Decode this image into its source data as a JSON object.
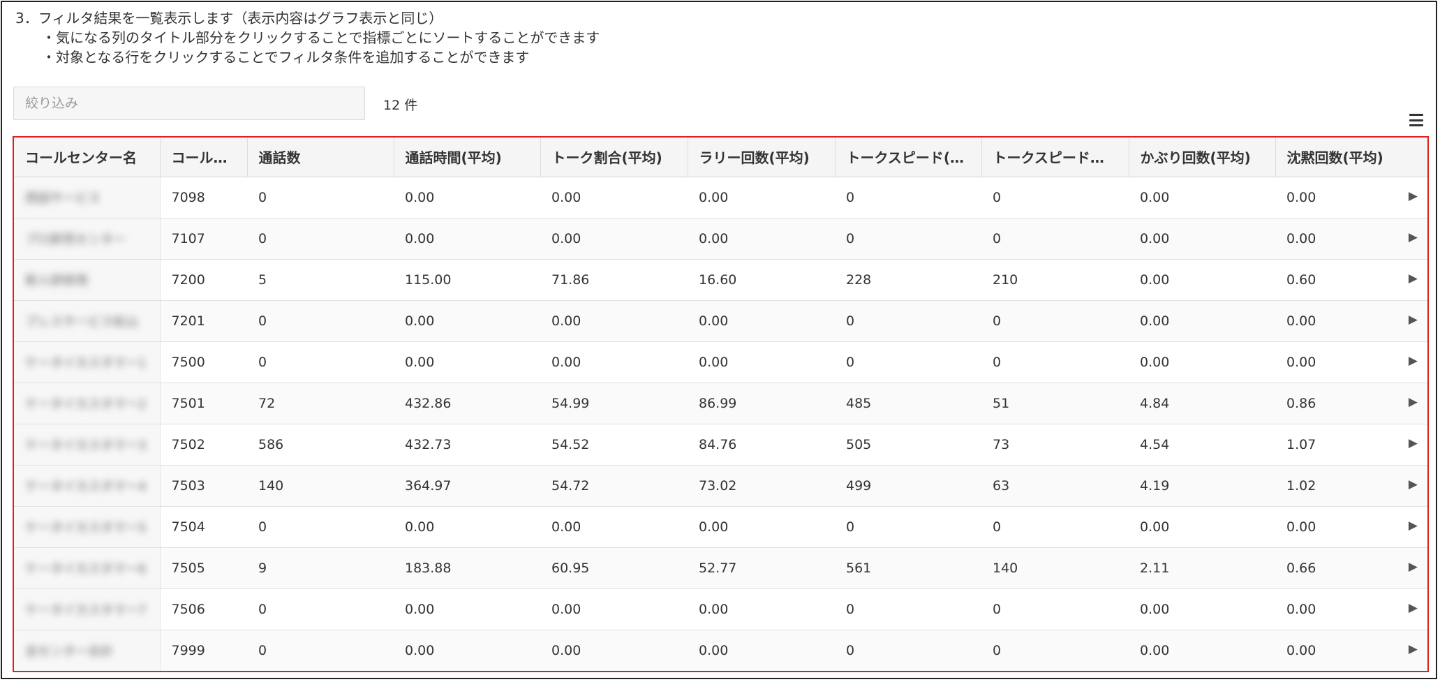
{
  "instructions": {
    "line1": "3．フィルタ結果を一覧表示します（表示内容はグラフ表示と同じ）",
    "line2": "・気になる列のタイトル部分をクリックすることで指標ごとにソートすることができます",
    "line3": "・対象となる行をクリックすることでフィルタ条件を追加することができます"
  },
  "filter": {
    "placeholder": "絞り込み",
    "value": ""
  },
  "count_label": "12 件",
  "icons": {
    "menu": "hamburger-menu-icon",
    "row": "play-arrow-icon"
  },
  "colors": {
    "highlight_border": "#e0201c"
  },
  "table": {
    "headers": [
      "コールセンター名",
      "コール…",
      "通話数",
      "通話時間(平均)",
      "トーク割合(平均)",
      "ラリー回数(平均)",
      "トークスピード(…",
      "トークスピード差…",
      "かぶり回数(平均)",
      "沈黙回数(平均)"
    ],
    "rows": [
      [
        "西田サービス",
        "7098",
        "0",
        "0.00",
        "0.00",
        "0.00",
        "0",
        "0",
        "0.00",
        "0.00"
      ],
      [
        "プロ卸売センター",
        "7107",
        "0",
        "0.00",
        "0.00",
        "0.00",
        "0",
        "0",
        "0.00",
        "0.00"
      ],
      [
        "新入研修用",
        "7200",
        "5",
        "115.00",
        "71.86",
        "16.60",
        "228",
        "210",
        "0.00",
        "0.60"
      ],
      [
        "ブレスサービス松山",
        "7201",
        "0",
        "0.00",
        "0.00",
        "0.00",
        "0",
        "0",
        "0.00",
        "0.00"
      ],
      [
        "ケータイカスタマー1",
        "7500",
        "0",
        "0.00",
        "0.00",
        "0.00",
        "0",
        "0",
        "0.00",
        "0.00"
      ],
      [
        "ケータイカスタマー2",
        "7501",
        "72",
        "432.86",
        "54.99",
        "86.99",
        "485",
        "51",
        "4.84",
        "0.86"
      ],
      [
        "ケータイカスタマー3",
        "7502",
        "586",
        "432.73",
        "54.52",
        "84.76",
        "505",
        "73",
        "4.54",
        "1.07"
      ],
      [
        "ケータイカスタマー4",
        "7503",
        "140",
        "364.97",
        "54.72",
        "73.02",
        "499",
        "63",
        "4.19",
        "1.02"
      ],
      [
        "ケータイカスタマー5",
        "7504",
        "0",
        "0.00",
        "0.00",
        "0.00",
        "0",
        "0",
        "0.00",
        "0.00"
      ],
      [
        "ケータイカスタマー6",
        "7505",
        "9",
        "183.88",
        "60.95",
        "52.77",
        "561",
        "140",
        "2.11",
        "0.66"
      ],
      [
        "ケータイカスタマー7",
        "7506",
        "0",
        "0.00",
        "0.00",
        "0.00",
        "0",
        "0",
        "0.00",
        "0.00"
      ],
      [
        "全センター合計",
        "7999",
        "0",
        "0.00",
        "0.00",
        "0.00",
        "0",
        "0",
        "0.00",
        "0.00"
      ]
    ]
  }
}
